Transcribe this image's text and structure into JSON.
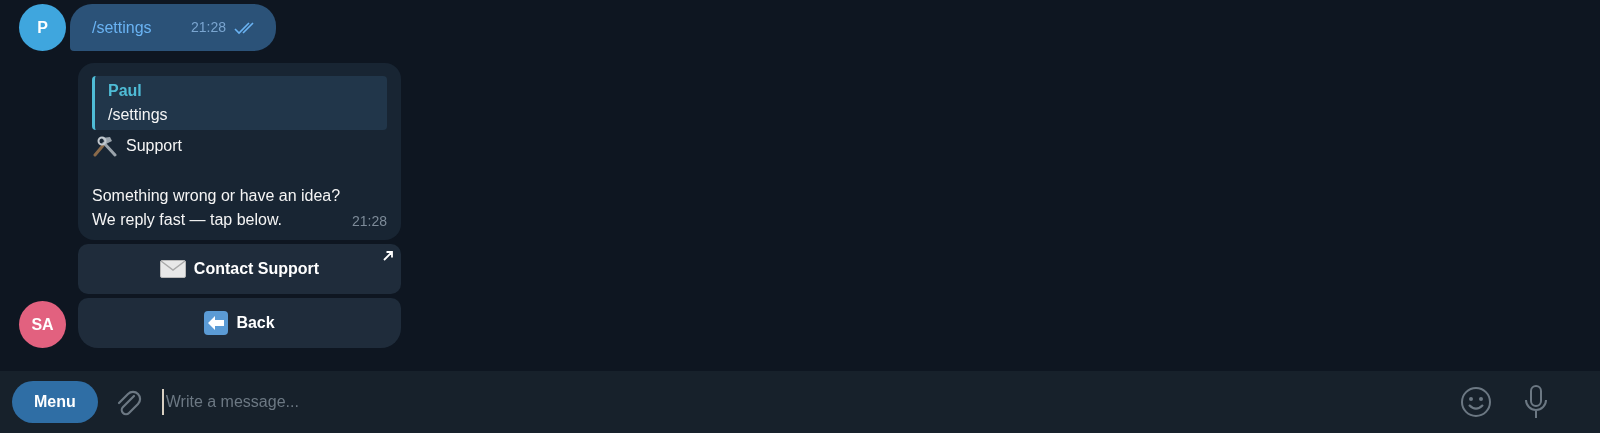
{
  "messages": [
    {
      "kind": "outgoing",
      "avatar": "P",
      "color": "#3fa6de",
      "text": "/settings",
      "time": "21:28",
      "read": true
    },
    {
      "kind": "bot",
      "avatar": "SA",
      "color": "#e2617f",
      "reply": {
        "name": "Paul",
        "text": "/settings"
      },
      "title": "Support",
      "lines": [
        "Something wrong or have an idea?",
        "We reply fast — tap below."
      ],
      "time": "21:28",
      "buttons": [
        {
          "label": "Contact Support",
          "kind": "mail",
          "external": true
        },
        {
          "label": "Back",
          "kind": "back",
          "external": false
        }
      ]
    }
  ],
  "composer": {
    "menu": "Menu",
    "placeholder": "Write a message..."
  }
}
